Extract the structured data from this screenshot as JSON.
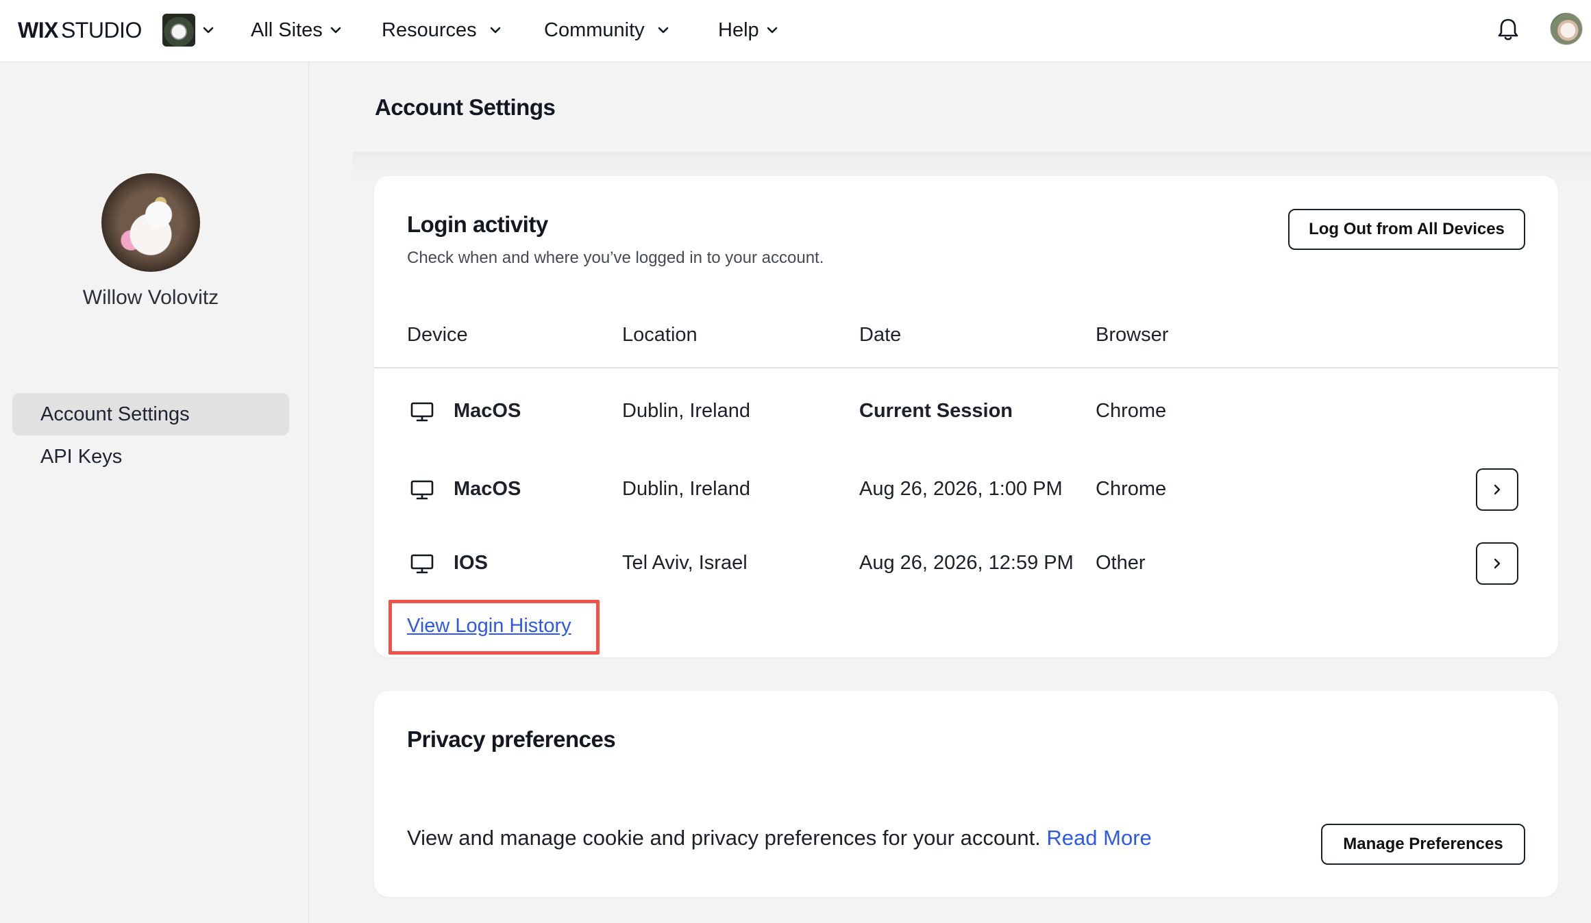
{
  "topbar": {
    "logo_bold": "WIX",
    "logo_light": "STUDIO",
    "nav": [
      {
        "label": "All Sites"
      },
      {
        "label": "Resources"
      },
      {
        "label": "Community"
      },
      {
        "label": "Help"
      }
    ],
    "icons": [
      "site-thumbnail-icon",
      "chevron-down-icon",
      "bell-icon",
      "user-avatar"
    ]
  },
  "sidebar": {
    "user_name": "Willow Volovitz",
    "items": [
      {
        "label": "Account Settings",
        "active": true
      },
      {
        "label": "API Keys",
        "active": false
      }
    ]
  },
  "main": {
    "page_title": "Account Settings",
    "login_activity": {
      "title": "Login activity",
      "subtitle": "Check when and where you’ve logged in to your account.",
      "logout_all_label": "Log Out from All Devices",
      "columns": [
        "Device",
        "Location",
        "Date",
        "Browser"
      ],
      "rows": [
        {
          "device": "MacOS",
          "location": "Dublin, Ireland",
          "date": "Current Session",
          "browser": "Chrome",
          "icon": "desktop-icon"
        },
        {
          "device": "MacOS",
          "location": "Dublin, Ireland",
          "date": "Aug 26, 2026, 1:00 PM",
          "browser": "Chrome",
          "icon": "desktop-icon"
        },
        {
          "device": "IOS",
          "location": "Tel Aviv, Israel",
          "date": "Aug 26, 2026, 12:59 PM",
          "browser": "Other",
          "icon": "desktop-icon"
        }
      ],
      "view_history_label": "View Login History"
    },
    "privacy": {
      "title": "Privacy preferences",
      "text": "View and manage cookie and privacy preferences for your account.",
      "link_label": "Read More",
      "button_label": "Manage Preferences"
    }
  },
  "colors": {
    "accent_link": "#2e59e8",
    "highlight": "#f05148",
    "background": "#f3f3f3"
  }
}
